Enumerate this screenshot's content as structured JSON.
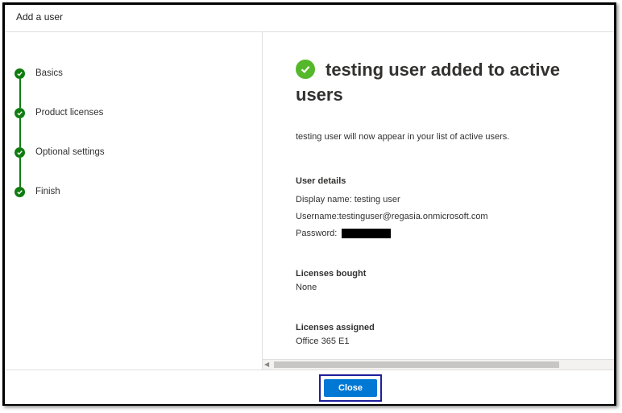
{
  "dialog": {
    "title": "Add a user"
  },
  "steps": [
    {
      "label": "Basics",
      "status": "complete"
    },
    {
      "label": "Product licenses",
      "status": "complete"
    },
    {
      "label": "Optional settings",
      "status": "complete"
    },
    {
      "label": "Finish",
      "status": "complete"
    }
  ],
  "result": {
    "headline": "testing user added to active users",
    "description": "testing user will now appear in your list of active users.",
    "user_details_heading": "User details",
    "display_name": "Display name: testing user",
    "username": "Username:testinguser@regasia.onmicrosoft.com",
    "password_label": "Password:",
    "licenses_bought_heading": "Licenses bought",
    "licenses_bought_value": "None",
    "licenses_assigned_heading": "Licenses assigned",
    "licenses_assigned_value": "Office 365 E1"
  },
  "footer": {
    "close_label": "Close"
  },
  "colors": {
    "step_complete": "#107c10",
    "success_icon": "#54b82a",
    "primary_button": "#0078d4",
    "focus_outline": "#1f1f9e"
  }
}
